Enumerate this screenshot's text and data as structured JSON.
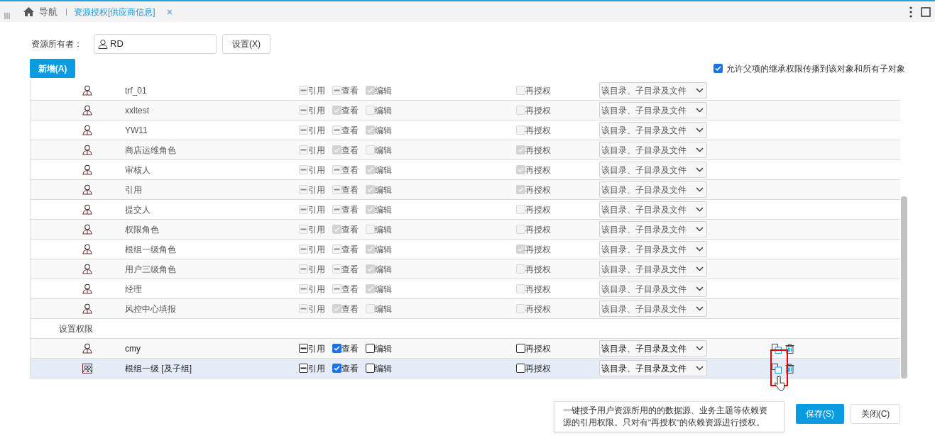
{
  "header": {
    "nav_label": "导航",
    "tabs": [
      {
        "label": "资源授权[供应商信息]",
        "selected": true
      }
    ]
  },
  "owner": {
    "label": "资源所有者：",
    "value": "RD",
    "button": "设置(X)"
  },
  "add_button": "新增(A)",
  "propagate": {
    "label": "允许父项的继承权限传播到该对象和所有子对象",
    "checked": true
  },
  "inherited_rows": [
    {
      "kind": "user",
      "name": "trf_01",
      "disabled": true,
      "selected": false,
      "permissions": [
        {
          "label": "引用",
          "checked": false,
          "partial": true
        },
        {
          "label": "查看",
          "checked": false,
          "partial": true
        },
        {
          "label": "编辑",
          "checked": true
        }
      ],
      "regrant": {
        "label": "再授权",
        "checked": false
      },
      "scope": "该目录、子目录及文件"
    },
    {
      "kind": "user",
      "name": "xxltest",
      "disabled": true,
      "selected": false,
      "permissions": [
        {
          "label": "引用",
          "checked": false,
          "partial": true
        },
        {
          "label": "查看",
          "checked": true
        },
        {
          "label": "编辑",
          "checked": false,
          "partial": false
        }
      ],
      "regrant": {
        "label": "再授权",
        "checked": false
      },
      "scope": "该目录、子目录及文件"
    },
    {
      "kind": "user",
      "name": "YW11",
      "disabled": true,
      "selected": false,
      "permissions": [
        {
          "label": "引用",
          "checked": false,
          "partial": true
        },
        {
          "label": "查看",
          "checked": false,
          "partial": true
        },
        {
          "label": "编辑",
          "checked": true
        }
      ],
      "regrant": {
        "label": "再授权",
        "checked": false
      },
      "scope": "该目录、子目录及文件"
    },
    {
      "kind": "user",
      "name": "商店运维角色",
      "disabled": true,
      "selected": false,
      "permissions": [
        {
          "label": "引用",
          "checked": false,
          "partial": true
        },
        {
          "label": "查看",
          "checked": true
        },
        {
          "label": "编辑",
          "checked": false,
          "partial": false
        }
      ],
      "regrant": {
        "label": "再授权",
        "checked": true
      },
      "scope": "该目录、子目录及文件"
    },
    {
      "kind": "user",
      "name": "审核人",
      "disabled": true,
      "selected": false,
      "permissions": [
        {
          "label": "引用",
          "checked": false,
          "partial": true
        },
        {
          "label": "查看",
          "checked": false,
          "partial": true
        },
        {
          "label": "编辑",
          "checked": true
        }
      ],
      "regrant": {
        "label": "再授权",
        "checked": true
      },
      "scope": "该目录、子目录及文件"
    },
    {
      "kind": "user",
      "name": "引用",
      "disabled": true,
      "selected": false,
      "permissions": [
        {
          "label": "引用",
          "checked": false,
          "partial": true
        },
        {
          "label": "查看",
          "checked": false,
          "partial": true
        },
        {
          "label": "编辑",
          "checked": true
        }
      ],
      "regrant": {
        "label": "再授权",
        "checked": true
      },
      "scope": "该目录、子目录及文件"
    },
    {
      "kind": "user",
      "name": "提交人",
      "disabled": true,
      "selected": false,
      "permissions": [
        {
          "label": "引用",
          "checked": false,
          "partial": true
        },
        {
          "label": "查看",
          "checked": false,
          "partial": true
        },
        {
          "label": "编辑",
          "checked": true
        }
      ],
      "regrant": {
        "label": "再授权",
        "checked": false
      },
      "scope": "该目录、子目录及文件"
    },
    {
      "kind": "user",
      "name": "权限角色",
      "disabled": true,
      "selected": false,
      "permissions": [
        {
          "label": "引用",
          "checked": false,
          "partial": true
        },
        {
          "label": "查看",
          "checked": true
        },
        {
          "label": "编辑",
          "checked": false,
          "partial": false
        }
      ],
      "regrant": {
        "label": "再授权",
        "checked": false
      },
      "scope": "该目录、子目录及文件"
    },
    {
      "kind": "user",
      "name": "根组一级角色",
      "disabled": true,
      "selected": false,
      "permissions": [
        {
          "label": "引用",
          "checked": false,
          "partial": true
        },
        {
          "label": "查看",
          "checked": false,
          "partial": true
        },
        {
          "label": "编辑",
          "checked": true
        }
      ],
      "regrant": {
        "label": "再授权",
        "checked": true
      },
      "scope": "该目录、子目录及文件"
    },
    {
      "kind": "user",
      "name": "用户三级角色",
      "disabled": true,
      "selected": false,
      "permissions": [
        {
          "label": "引用",
          "checked": false,
          "partial": true
        },
        {
          "label": "查看",
          "checked": false,
          "partial": true
        },
        {
          "label": "编辑",
          "checked": true
        }
      ],
      "regrant": {
        "label": "再授权",
        "checked": false
      },
      "scope": "该目录、子目录及文件"
    },
    {
      "kind": "user",
      "name": "经理",
      "disabled": true,
      "selected": false,
      "permissions": [
        {
          "label": "引用",
          "checked": false,
          "partial": true
        },
        {
          "label": "查看",
          "checked": false,
          "partial": true
        },
        {
          "label": "编辑",
          "checked": true
        }
      ],
      "regrant": {
        "label": "再授权",
        "checked": false
      },
      "scope": "该目录、子目录及文件"
    },
    {
      "kind": "user",
      "name": "风控中心填报",
      "disabled": true,
      "selected": false,
      "permissions": [
        {
          "label": "引用",
          "checked": false,
          "partial": true
        },
        {
          "label": "查看",
          "checked": true
        },
        {
          "label": "编辑",
          "checked": false,
          "partial": false
        }
      ],
      "regrant": {
        "label": "再授权",
        "checked": false
      },
      "scope": "该目录、子目录及文件"
    }
  ],
  "section_title": "设置权限",
  "set_rows": [
    {
      "kind": "user",
      "name": "cmy",
      "disabled": false,
      "selected": false,
      "permissions": [
        {
          "label": "引用",
          "checked": false,
          "partial": true
        },
        {
          "label": "查看",
          "checked": true
        },
        {
          "label": "编辑",
          "checked": false,
          "partial": false
        }
      ],
      "regrant": {
        "label": "再授权",
        "checked": false
      },
      "scope": "该目录、子目录及文件"
    },
    {
      "kind": "group",
      "name": "根组一级 [及子组]",
      "disabled": false,
      "selected": true,
      "permissions": [
        {
          "label": "引用",
          "checked": false,
          "partial": true
        },
        {
          "label": "查看",
          "checked": true
        },
        {
          "label": "编辑",
          "checked": false,
          "partial": false
        }
      ],
      "regrant": {
        "label": "再授权",
        "checked": false
      },
      "scope": "该目录、子目录及文件"
    }
  ],
  "tooltip": "一键授予用户资源所用的的数据源、业务主题等依赖资源的引用权限。只对有\"再授权\"的依赖资源进行授权。",
  "footer_buttons": [
    {
      "kind": "primary",
      "label": "保存(S)"
    },
    {
      "kind": "secondary",
      "label": "关闭(C)"
    }
  ]
}
